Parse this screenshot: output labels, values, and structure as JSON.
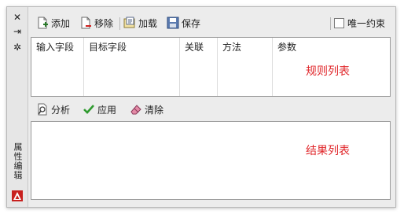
{
  "strip": {
    "close_glyph": "✕",
    "pin_glyph": "⇥",
    "settings_glyph": "✲",
    "vertical_title": "属性编辑"
  },
  "toolbar": {
    "add_label": "添加",
    "remove_label": "移除",
    "load_label": "加载",
    "save_label": "保存",
    "unique_constraint_label": "唯一约束"
  },
  "rule_table": {
    "columns": [
      "输入字段",
      "目标字段",
      "关联",
      "方法",
      "参数"
    ],
    "empty_label": "规则列表"
  },
  "toolbar2": {
    "analyze_label": "分析",
    "apply_label": "应用",
    "clear_label": "清除"
  },
  "result_list": {
    "empty_label": "结果列表"
  },
  "colors": {
    "placeholder_red": "#e0262a",
    "apply_green": "#2e9a2e"
  }
}
